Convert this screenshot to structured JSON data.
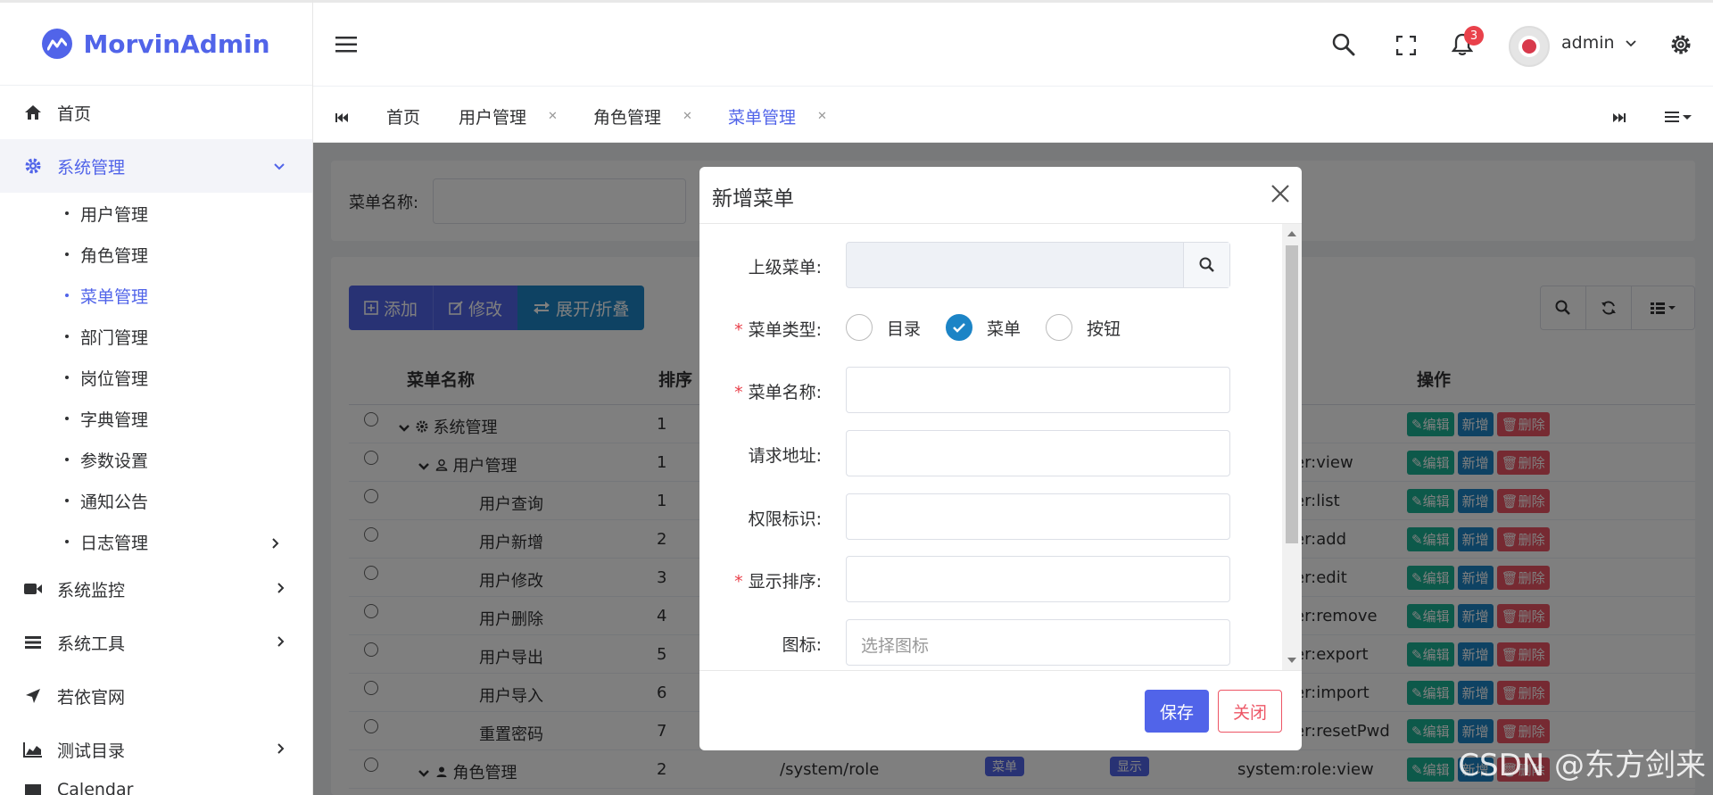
{
  "brand": {
    "name": "MorvinAdmin"
  },
  "sidebar": {
    "home": "首页",
    "system": "系统管理",
    "sub_items": [
      "用户管理",
      "角色管理",
      "菜单管理",
      "部门管理",
      "岗位管理",
      "字典管理",
      "参数设置",
      "通知公告",
      "日志管理"
    ],
    "monitor": "系统监控",
    "tools": "系统工具",
    "ruoyi": "若依官网",
    "test": "测试目录",
    "partial": "Calendar"
  },
  "header": {
    "notification_count": "3",
    "username": "admin"
  },
  "tabs": [
    "首页",
    "用户管理",
    "角色管理",
    "菜单管理"
  ],
  "search": {
    "label": "菜单名称:"
  },
  "toolbar": {
    "add": "添加",
    "edit": "修改",
    "expand": "展开/折叠"
  },
  "table": {
    "headers": {
      "name": "菜单名称",
      "order": "排序",
      "action": "操作"
    },
    "rows": [
      {
        "name": "系统管理",
        "order": "1",
        "perm": ""
      },
      {
        "name": "用户管理",
        "order": "1",
        "perm": "er:view"
      },
      {
        "name": "用户查询",
        "order": "1",
        "perm": "er:list"
      },
      {
        "name": "用户新增",
        "order": "2",
        "perm": "er:add"
      },
      {
        "name": "用户修改",
        "order": "3",
        "perm": "er:edit"
      },
      {
        "name": "用户删除",
        "order": "4",
        "perm": "er:remove"
      },
      {
        "name": "用户导出",
        "order": "5",
        "perm": "er:export"
      },
      {
        "name": "用户导入",
        "order": "6",
        "perm": "er:import"
      },
      {
        "name": "重置密码",
        "order": "7",
        "perm": "er:resetPwd"
      },
      {
        "name": "角色管理",
        "order": "2",
        "url": "/system/role",
        "type": "菜单",
        "visible": "显示",
        "perm": "system:role:view"
      }
    ],
    "ops": {
      "edit": "编辑",
      "add": "新增",
      "delete": "删除"
    }
  },
  "dialog": {
    "title": "新增菜单",
    "fields": {
      "parent": "上级菜单:",
      "type": "菜单类型:",
      "name": "菜单名称:",
      "url": "请求地址:",
      "perms": "权限标识:",
      "order": "显示排序:",
      "icon": "图标:"
    },
    "type_options": [
      "目录",
      "菜单",
      "按钮"
    ],
    "type_selected": "菜单",
    "icon_placeholder": "选择图标",
    "save": "保存",
    "close": "关闭"
  },
  "watermark": "CSDN @东方剑来",
  "colors": {
    "primary": "#5164e9",
    "success": "#1ab394",
    "info": "#1c84c6",
    "danger": "#ed5565",
    "badge": "#e9414b"
  }
}
